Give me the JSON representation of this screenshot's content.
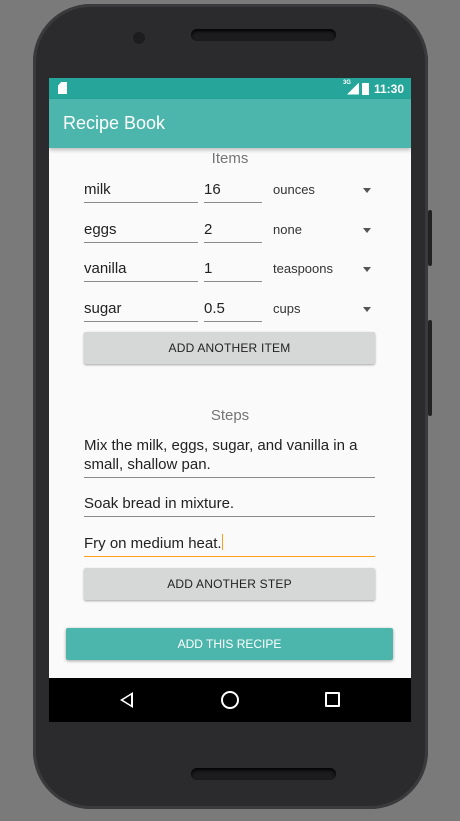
{
  "status_bar": {
    "network": "3G",
    "time": "11:30"
  },
  "app_bar": {
    "title": "Recipe Book"
  },
  "items_section": {
    "title": "Items",
    "items": [
      {
        "name": "milk",
        "quantity": "16",
        "unit": "ounces"
      },
      {
        "name": "eggs",
        "quantity": "2",
        "unit": "none"
      },
      {
        "name": "vanilla",
        "quantity": "1",
        "unit": "teaspoons"
      },
      {
        "name": "sugar",
        "quantity": "0.5",
        "unit": "cups"
      }
    ],
    "add_button": "ADD ANOTHER ITEM"
  },
  "steps_section": {
    "title": "Steps",
    "steps": [
      "Mix the milk, eggs, sugar, and vanilla in a small, shallow pan.",
      "Soak bread in mixture.",
      "Fry on medium heat."
    ],
    "add_button": "ADD ANOTHER STEP"
  },
  "submit_button": "ADD THIS RECIPE",
  "colors": {
    "status_bar": "#26a69a",
    "app_bar": "#4db6ac",
    "accent": "#ff9f1c"
  },
  "icons": {
    "status": [
      "sd-card-icon",
      "signal-icon",
      "battery-icon"
    ],
    "unit_dropdown": "caret-down-icon",
    "nav": [
      "back-icon",
      "home-icon",
      "recents-icon"
    ]
  }
}
